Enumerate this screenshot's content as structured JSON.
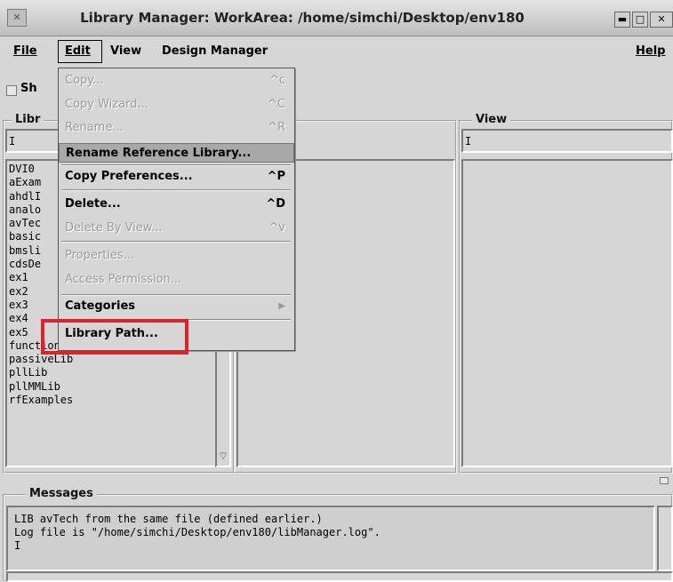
{
  "window": {
    "title": "Library Manager: WorkArea: /home/simchi/Desktop/env180",
    "icon": "app-icon",
    "controls": [
      "▬",
      "□",
      "✕"
    ]
  },
  "menubar": {
    "file": "File",
    "edit": "Edit",
    "view": "View",
    "design_manager": "Design Manager",
    "help": "Help"
  },
  "options": {
    "show_label": "Sh"
  },
  "library_panel": {
    "caption": "Libr",
    "filter_value": "I",
    "items": [
      "DVI0",
      "aExam",
      "ahdlI",
      "analo",
      "avTec",
      "basic",
      "bmsli",
      "cdsDe",
      "ex1",
      "ex2",
      "ex3",
      "ex4",
      "ex5",
      "functional",
      "passiveLib",
      "pllLib",
      "pllMMLib",
      "rfExamples"
    ]
  },
  "view_panel": {
    "caption": "View",
    "filter_value": "I"
  },
  "edit_menu": {
    "items": [
      {
        "label": "Copy...",
        "shortcut": "^c",
        "enabled": false
      },
      {
        "label": "Copy Wizard...",
        "shortcut": "^C",
        "enabled": false
      },
      {
        "label": "Rename...",
        "shortcut": "^R",
        "enabled": false
      },
      {
        "label": "Rename Reference Library...",
        "shortcut": "",
        "enabled": true,
        "highlighted": true
      },
      {
        "label": "Copy Preferences...",
        "shortcut": "^P",
        "enabled": true
      },
      {
        "label": "Delete...",
        "shortcut": "^D",
        "enabled": true
      },
      {
        "label": "Delete By View...",
        "shortcut": "^v",
        "enabled": false
      },
      {
        "label": "Properties...",
        "shortcut": "",
        "enabled": false
      },
      {
        "label": "Access Permission...",
        "shortcut": "",
        "enabled": false
      },
      {
        "label": "Categories",
        "shortcut": "▶",
        "enabled": true
      },
      {
        "label": "Library Path...",
        "shortcut": "",
        "enabled": true
      }
    ]
  },
  "messages": {
    "caption": "Messages",
    "lines": [
      "LIB avTech from the same file (defined earlier.)",
      "Log file is \"/home/simchi/Desktop/env180/libManager.log\".",
      "I"
    ]
  },
  "highlight_color": "#e0202a"
}
